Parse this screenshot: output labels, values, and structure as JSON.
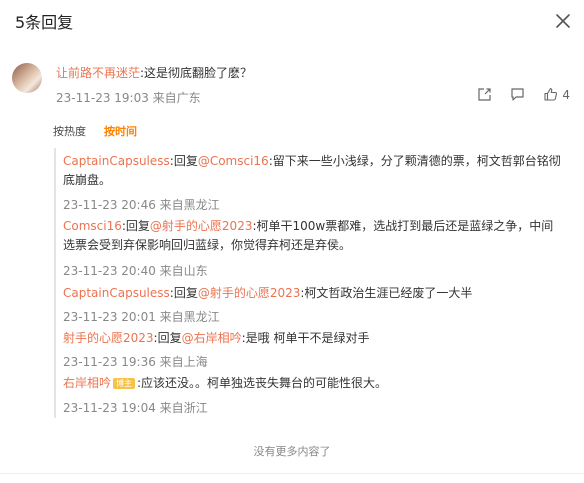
{
  "header": {
    "title": "5条回复"
  },
  "main_comment": {
    "username": "让前路不再迷茫",
    "text": ":这是彻底翻脸了麽？",
    "meta": "23-11-23 19:03 来自广东",
    "like_count": "4"
  },
  "sort": {
    "hot": "按热度",
    "time": "按时间"
  },
  "replies": [
    {
      "user": "CaptainCapsuless",
      "mid": ":回复",
      "target": "@Comsci16",
      "text": ":留下来一些小浅绿，分了颗清德的票，柯文哲郭台铭彻底崩盘。",
      "meta": "23-11-23 20:46 来自黑龙江"
    },
    {
      "user": "Comsci16",
      "mid": ":回复",
      "target": "@射手的心愿2023",
      "text": ":柯单干100w票都难，选战打到最后还是蓝绿之争，中间选票会受到弃保影响回归蓝绿，你觉得弃柯还是弃侯。",
      "meta": "23-11-23 20:40 来自山东"
    },
    {
      "user": "CaptainCapsuless",
      "mid": ":回复",
      "target": "@射手的心愿2023",
      "text": ":柯文哲政治生涯已经废了一大半",
      "meta": "23-11-23 20:01 来自黑龙江"
    },
    {
      "user": "射手的心愿2023",
      "mid": ":回复",
      "target": "@右岸相吟",
      "text": ":是哦 柯单干不是绿对手",
      "meta": "23-11-23 19:36 来自上海"
    },
    {
      "user": "右岸相吟",
      "badge": "博主",
      "text": ":应该还没。。柯单独选丧失舞台的可能性很大。",
      "meta": "23-11-23 19:04 来自浙江"
    }
  ],
  "footer": {
    "no_more": "没有更多内容了"
  },
  "colors": {
    "username": "#eb7350",
    "sort_active": "#ff8200",
    "meta": "#888888",
    "badge": "#f7c24b"
  },
  "icons": [
    "close-icon",
    "share-icon",
    "comment-icon",
    "like-icon"
  ]
}
